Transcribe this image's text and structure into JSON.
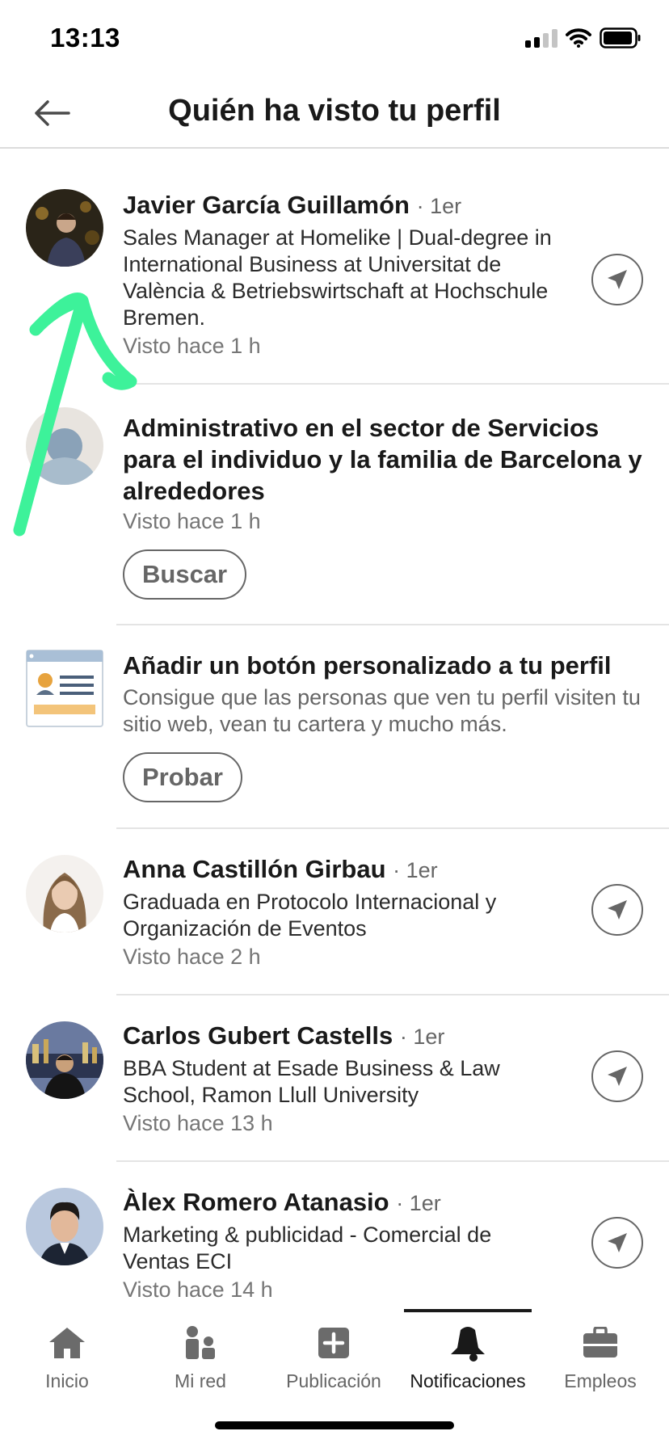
{
  "status_bar": {
    "time": "13:13"
  },
  "header": {
    "title": "Quién ha visto tu perfil"
  },
  "viewers": [
    {
      "name": "Javier García Guillamón",
      "degree": "· 1er",
      "headline": "Sales Manager at Homelike | Dual-degree in International Business at Universitat de València & Betriebswirtschaft at Hochschule Bremen.",
      "seen": "Visto hace 1 h"
    },
    {
      "name": "Anna Castillón Girbau",
      "degree": "· 1er",
      "headline": "Graduada en Protocolo Internacional y Organización de Eventos",
      "seen": "Visto hace 2 h"
    },
    {
      "name": "Carlos Gubert Castells",
      "degree": "· 1er",
      "headline": "BBA Student at Esade Business & Law School, Ramon Llull University",
      "seen": "Visto hace 13 h"
    },
    {
      "name": "Àlex Romero Atanasio",
      "degree": "· 1er",
      "headline": "Marketing & publicidad - Comercial de Ventas ECI",
      "seen": "Visto hace 14 h"
    }
  ],
  "anonymous": {
    "title": "Administrativo en el sector de Servicios para el individuo y la familia de Barcelona y alrededores",
    "seen": "Visto hace 1 h",
    "button": "Buscar"
  },
  "promo": {
    "title": "Añadir un botón personalizado a tu perfil",
    "description": "Consigue que las personas que ven tu perfil visiten tu sitio web, vean tu cartera y mucho más.",
    "button": "Probar"
  },
  "tabbar": {
    "tabs": [
      {
        "label": "Inicio",
        "icon": "home-icon"
      },
      {
        "label": "Mi red",
        "icon": "people-icon"
      },
      {
        "label": "Publicación",
        "icon": "plus-square-icon"
      },
      {
        "label": "Notificaciones",
        "icon": "bell-icon"
      },
      {
        "label": "Empleos",
        "icon": "briefcase-icon"
      }
    ],
    "active": "Notificaciones"
  },
  "colors": {
    "text_primary": "#191919",
    "text_secondary": "#666666",
    "divider": "#e4e4e4",
    "annotation_stroke": "#3df29a"
  }
}
